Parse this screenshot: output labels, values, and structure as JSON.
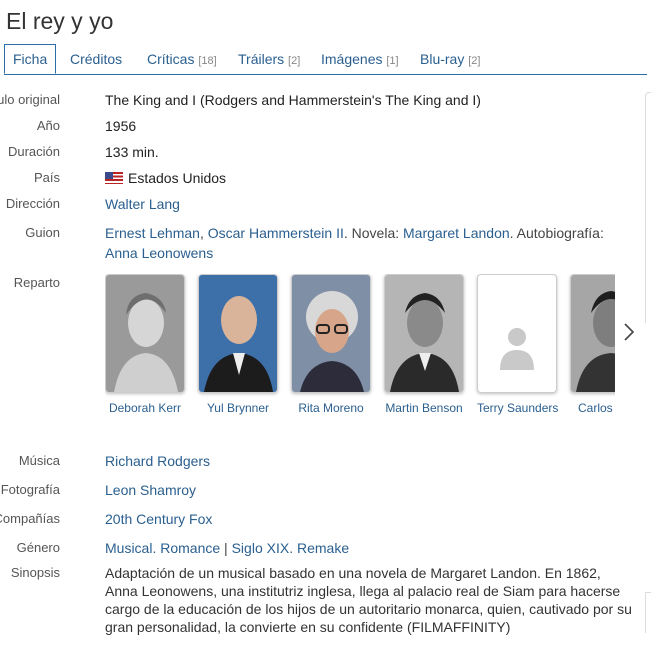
{
  "title": "El rey y yo",
  "tabs": [
    {
      "label": "Ficha",
      "count": ""
    },
    {
      "label": "Créditos",
      "count": ""
    },
    {
      "label": "Críticas",
      "count": "[18]"
    },
    {
      "label": "Tráilers",
      "count": "[2]"
    },
    {
      "label": "Imágenes",
      "count": "[1]"
    },
    {
      "label": "Blu-ray",
      "count": "[2]"
    }
  ],
  "labels": {
    "original_title": "Título original",
    "year": "Año",
    "duration": "Duración",
    "country": "País",
    "director": "Dirección",
    "screenplay": "Guion",
    "cast": "Reparto",
    "music": "Música",
    "photography": "Fotografía",
    "companies": "Compañías",
    "genre": "Género",
    "synopsis": "Sinopsis"
  },
  "values": {
    "original_title": "The King and I (Rodgers and Hammerstein's The King and I)",
    "year": "1956",
    "duration": "133 min.",
    "country": "Estados Unidos",
    "director": "Walter Lang",
    "screenplay": {
      "writer1": "Ernest Lehman",
      "sep1": ", ",
      "writer2": "Oscar Hammerstein II",
      "novel_prefix": ". Novela: ",
      "novelist": "Margaret Landon",
      "auto_prefix": ". Autobiografía:",
      "autobiographer": "Anna Leonowens"
    },
    "music": "Richard Rodgers",
    "photography": "Leon Shamroy",
    "companies": "20th Century Fox",
    "genre": {
      "g1": "Musical",
      "sep1": ". ",
      "g2": "Romance",
      "sep2": " | ",
      "g3": "Siglo XIX",
      "sep3": ". ",
      "g4": "Remake"
    },
    "synopsis": "Adaptación de un musical basado en una novela de Margaret Landon. En 1862, Anna Leonowens, una institutriz inglesa, llega al palacio real de Siam para hacerse cargo de la educación de los hijos de un autoritario monarca, quien, cautivado por su gran personalidad, la convierte en su confidente (FILMAFFINITY)"
  },
  "cast": [
    {
      "name": "Deborah Kerr"
    },
    {
      "name": "Yul Brynner"
    },
    {
      "name": "Rita Moreno"
    },
    {
      "name": "Martin Benson"
    },
    {
      "name": "Terry Saunders"
    },
    {
      "name": "Carlos"
    }
  ],
  "icons": {
    "next": "chevron-right-icon",
    "flag": "us-flag-icon",
    "placeholder": "person-placeholder-icon"
  },
  "colors": {
    "link": "#2a5f8f",
    "tab_border": "#2b6da8"
  }
}
